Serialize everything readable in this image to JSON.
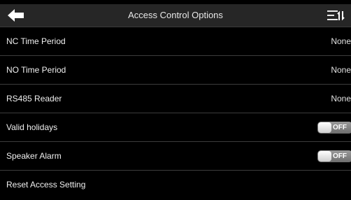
{
  "header": {
    "title": "Access Control Options",
    "back_icon": "back-arrow-icon",
    "sort_icon": "sort-list-icon"
  },
  "rows": [
    {
      "label": "NC Time Period",
      "value": "None"
    },
    {
      "label": "NO Time Period",
      "value": "None"
    },
    {
      "label": "RS485 Reader",
      "value": "None"
    },
    {
      "label": "Valid holidays",
      "toggle": "OFF"
    },
    {
      "label": "Speaker Alarm",
      "toggle": "OFF"
    },
    {
      "label": "Reset Access Setting"
    }
  ],
  "colors": {
    "background": "#000000",
    "header": "#262626",
    "divider": "#3c3c3c",
    "text": "#f0f0f0",
    "toggle_off": "#7f7f7f"
  }
}
